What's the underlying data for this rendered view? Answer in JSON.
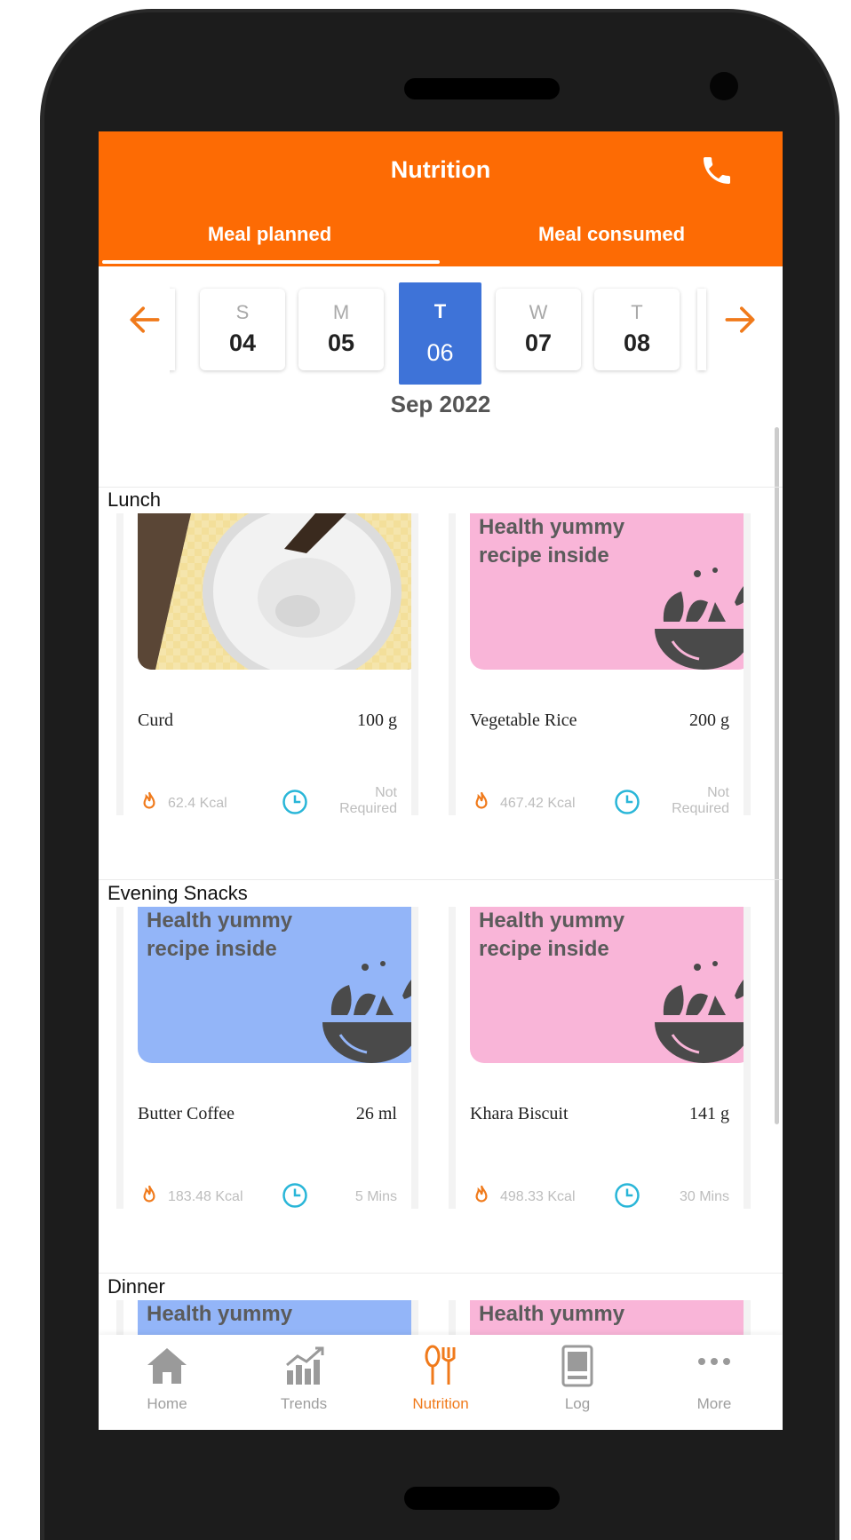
{
  "header": {
    "title": "Nutrition"
  },
  "tabs": [
    {
      "label": "Meal planned",
      "active": true
    },
    {
      "label": "Meal consumed",
      "active": false
    }
  ],
  "calendar": {
    "days": [
      {
        "letter": "S",
        "date": "04"
      },
      {
        "letter": "M",
        "date": "05"
      },
      {
        "letter": "T",
        "date": "06",
        "selected": true
      },
      {
        "letter": "W",
        "date": "07"
      },
      {
        "letter": "T",
        "date": "08"
      }
    ],
    "month": "Sep 2022"
  },
  "sections": [
    {
      "label": "Lunch",
      "items": [
        {
          "name": "Curd",
          "qty": "100 g",
          "kcal": "62.4 Kcal",
          "time": "Not Required",
          "image": "curd-photo"
        },
        {
          "name": "Vegetable Rice",
          "qty": "200 g",
          "kcal": "467.42 Kcal",
          "time": "Not Required",
          "image": "placeholder-pink",
          "image_text": "Health yummy recipe inside"
        }
      ]
    },
    {
      "label": "Evening Snacks",
      "items": [
        {
          "name": "Butter Coffee",
          "qty": "26 ml",
          "kcal": "183.48 Kcal",
          "time": "5 Mins",
          "image": "placeholder-blue",
          "image_text": "Health yummy recipe inside"
        },
        {
          "name": "Khara Biscuit",
          "qty": "141 g",
          "kcal": "498.33 Kcal",
          "time": "30 Mins",
          "image": "placeholder-pink",
          "image_text": "Health yummy recipe inside"
        }
      ]
    },
    {
      "label": "Dinner",
      "items": [
        {
          "image": "placeholder-blue",
          "image_text": "Health yummy"
        },
        {
          "image": "placeholder-pink",
          "image_text": "Health yummy"
        }
      ]
    }
  ],
  "bottom_nav": [
    {
      "label": "Home",
      "icon": "home-icon"
    },
    {
      "label": "Trends",
      "icon": "trends-icon"
    },
    {
      "label": "Nutrition",
      "icon": "nutrition-icon",
      "active": true
    },
    {
      "label": "Log",
      "icon": "log-icon"
    },
    {
      "label": "More",
      "icon": "more-icon"
    }
  ],
  "colors": {
    "accent": "#fd6b04",
    "selected_day": "#3e73d8",
    "placeholder_pink": "#f9b5d8",
    "placeholder_blue": "#93b5f8",
    "clock": "#29b6d8",
    "flame": "#f07a1b"
  }
}
